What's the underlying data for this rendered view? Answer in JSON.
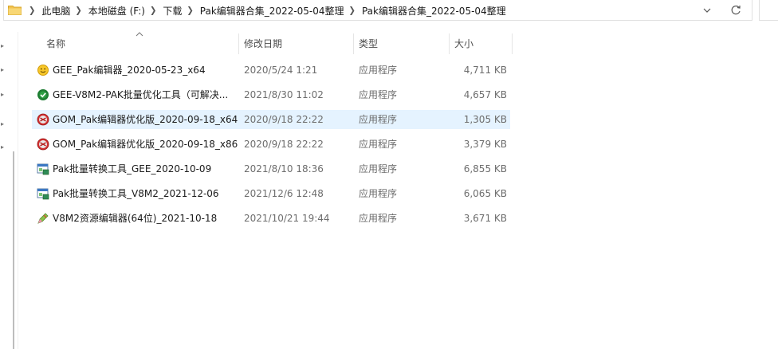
{
  "address": {
    "crumbs": [
      "此电脑",
      "本地磁盘 (F:)",
      "下载",
      "Pak编辑器合集_2022-05-04整理",
      "Pak编辑器合集_2022-05-04整理"
    ]
  },
  "columns": {
    "name": "名称",
    "date": "修改日期",
    "type": "类型",
    "size": "大小"
  },
  "files": [
    {
      "name": "GEE_Pak编辑器_2020-05-23_x64",
      "date": "2020/5/24 1:21",
      "type": "应用程序",
      "size": "4,711 KB",
      "icon": "smiley-app-icon"
    },
    {
      "name": "GEE-V8M2-PAK批量优化工具（可解决...",
      "date": "2021/8/30 11:02",
      "type": "应用程序",
      "size": "4,657 KB",
      "icon": "green-gear-app-icon"
    },
    {
      "name": "GOM_Pak编辑器优化版_2020-09-18_x64",
      "date": "2020/9/18 22:22",
      "type": "应用程序",
      "size": "1,305 KB",
      "icon": "red-ox-app-icon"
    },
    {
      "name": "GOM_Pak编辑器优化版_2020-09-18_x86",
      "date": "2020/9/18 22:22",
      "type": "应用程序",
      "size": "3,379 KB",
      "icon": "red-ox-app-icon"
    },
    {
      "name": "Pak批量转换工具_GEE_2020-10-09",
      "date": "2021/8/10 18:36",
      "type": "应用程序",
      "size": "6,855 KB",
      "icon": "window-app-icon"
    },
    {
      "name": "Pak批量转换工具_V8M2_2021-12-06",
      "date": "2021/12/6 12:48",
      "type": "应用程序",
      "size": "6,065 KB",
      "icon": "window-app-icon"
    },
    {
      "name": "V8M2资源编辑器(64位)_2021-10-18",
      "date": "2021/10/21 19:44",
      "type": "应用程序",
      "size": "3,671 KB",
      "icon": "pencil-app-icon"
    }
  ],
  "selected_index": 2,
  "colors": {
    "selected_row": "#e5f3ff",
    "folder": "#f2c24f"
  }
}
